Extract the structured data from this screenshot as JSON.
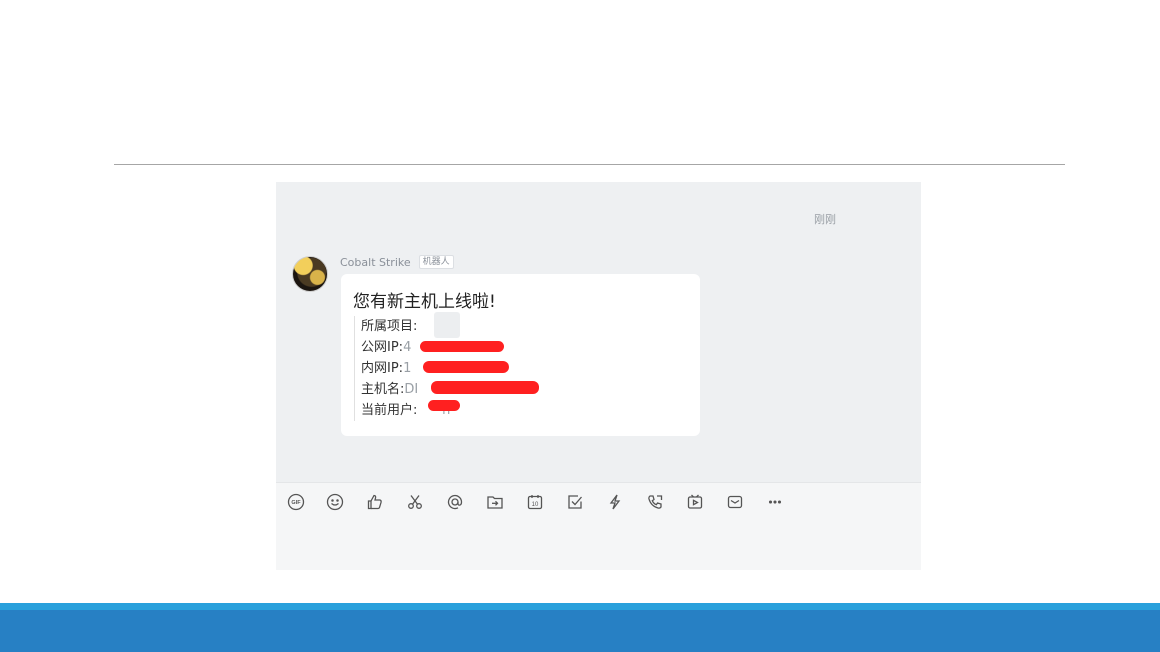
{
  "chat": {
    "timestamp": "刚刚",
    "sender": {
      "name": "Cobalt Strike",
      "tag": "机器人"
    },
    "message": {
      "title": "您有新主机上线啦!",
      "fields": [
        {
          "label": "所属项目:",
          "value": ""
        },
        {
          "label": "公网IP:",
          "value": "4"
        },
        {
          "label": "内网IP:",
          "value": "1              77"
        },
        {
          "label": "主机名:",
          "value": "DI                    YA"
        },
        {
          "label": "当前用户:",
          "value": "      n"
        }
      ]
    }
  },
  "toolbar": {
    "icons": [
      "gif-icon",
      "emoji-icon",
      "thumbs-up-icon",
      "scissors-icon",
      "at-icon",
      "folder-send-icon",
      "calendar-icon",
      "checkbox-icon",
      "lightning-icon",
      "phone-icon",
      "video-icon",
      "mail-icon",
      "more-icon"
    ]
  },
  "colors": {
    "footer": "#2780c4",
    "footer_strip": "#29a0dc",
    "redaction": "#ff2020",
    "chat_bg": "#eef0f2"
  }
}
